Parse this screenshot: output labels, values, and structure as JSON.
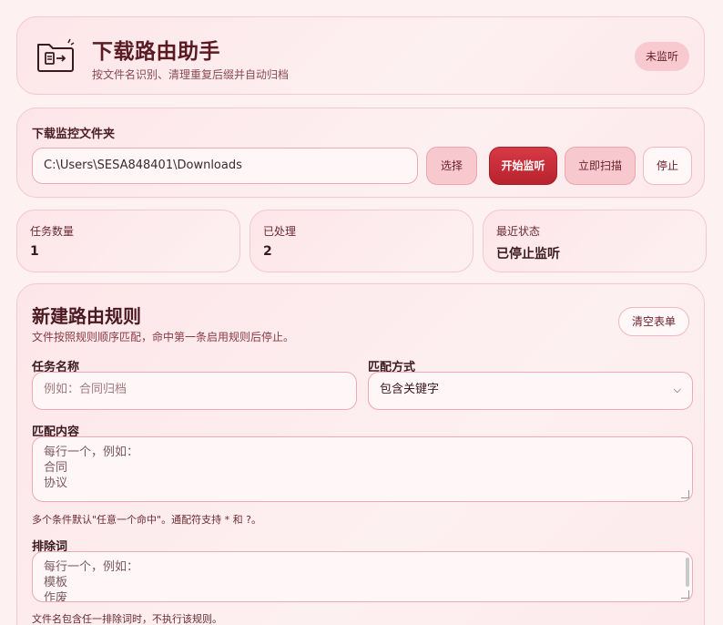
{
  "header": {
    "title": "下载路由助手",
    "subtitle": "按文件名识别、清理重复后缀并自动归档",
    "status": "未监听"
  },
  "folder": {
    "label": "下载监控文件夹",
    "path": "C:\\Users\\SESA848401\\Downloads",
    "buttons": {
      "choose": "选择",
      "start": "开始监听",
      "scan": "立即扫描",
      "stop": "停止"
    }
  },
  "stats": [
    {
      "label": "任务数量",
      "value": "1"
    },
    {
      "label": "已处理",
      "value": "2"
    },
    {
      "label": "最近状态",
      "value": "已停止监听"
    }
  ],
  "rules": {
    "title": "新建路由规则",
    "subtitle": "文件按照规则顺序匹配，命中第一条启用规则后停止。",
    "clear_label": "清空表单",
    "task_name_label": "任务名称",
    "task_name_placeholder": "例如：合同归档",
    "match_mode_label": "匹配方式",
    "match_mode_value": "包含关键字",
    "match_content_label": "匹配内容",
    "match_content_placeholder": [
      "每行一个，例如：",
      "合同",
      "协议"
    ],
    "match_hint": "多个条件默认\"任意一个命中\"。通配符支持 * 和 ?。",
    "exclude_label": "排除词",
    "exclude_placeholder": [
      "每行一个，例如：",
      "模板",
      "作废"
    ],
    "exclude_hint": "文件名包含任一排除词时，不执行该规则。"
  },
  "colors": {
    "accent": "#c62f3a",
    "background": "#fdf1f2",
    "border": "#f6c7cd"
  }
}
